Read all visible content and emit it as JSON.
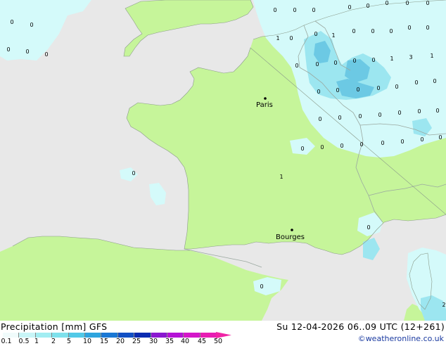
{
  "header": {
    "title": "Precipitation [mm] GFS",
    "datetime": "Su 12-04-2026 06..09 UTC (12+261)"
  },
  "credit": "©weatheronline.co.uk",
  "legend": {
    "labels": [
      "0.1",
      "0.5",
      "1",
      "2",
      "5",
      "10",
      "15",
      "20",
      "25",
      "30",
      "35",
      "40",
      "45",
      "50"
    ],
    "colors": [
      "#f0fbfb",
      "#c8f5f7",
      "#a2edf2",
      "#7ee1ec",
      "#52c9e7",
      "#2ea4de",
      "#1a78d4",
      "#1250c4",
      "#0a2bb0",
      "#8a18d0",
      "#b412d6",
      "#d416c9",
      "#e81cb3"
    ]
  },
  "map": {
    "land_color": "#c6f59a",
    "sea_color": "#e8e8e8",
    "precip_light": "#d4fafa",
    "precip_medium": "#9ce6f0",
    "precip_heavy": "#6cc9e4",
    "cities": [
      {
        "name": "Paris"
      },
      {
        "name": "Bourges"
      }
    ],
    "values": [
      "0",
      "0",
      "0",
      "0",
      "0",
      "0",
      "0",
      "0",
      "0",
      "0",
      "0",
      "0",
      "0",
      "1",
      "0",
      "0",
      "1",
      "0",
      "0",
      "0",
      "0",
      "0",
      "0",
      "0",
      "0",
      "0",
      "0",
      "1",
      "3",
      "1",
      "0",
      "0",
      "0",
      "0",
      "0",
      "0",
      "0",
      "0",
      "0",
      "0",
      "0",
      "0",
      "0",
      "0",
      "0",
      "0",
      "0",
      "0",
      "0",
      "0",
      "0",
      "0",
      "0",
      "1",
      "0",
      "0",
      "2"
    ]
  }
}
